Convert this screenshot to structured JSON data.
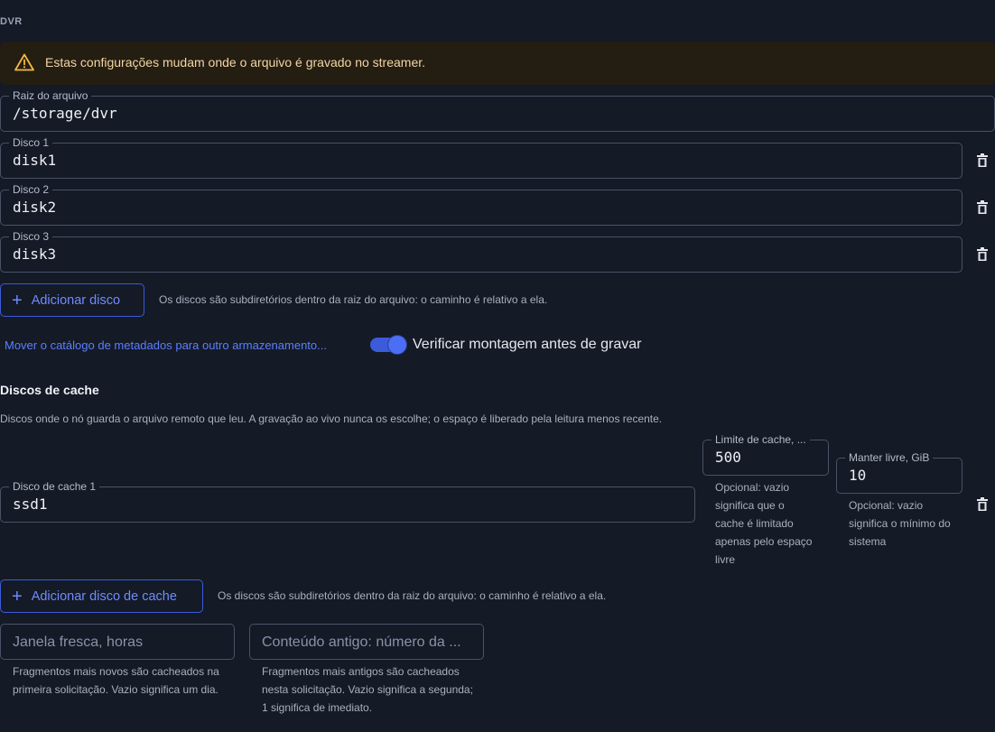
{
  "section": {
    "title": "DVR"
  },
  "warning": {
    "text": "Estas configurações mudam onde o arquivo é gravado no streamer.",
    "icon": "warning-triangle-icon",
    "color": "#f5b942"
  },
  "archive_root": {
    "label": "Raiz do arquivo",
    "value": "/storage/dvr"
  },
  "disks": [
    {
      "label": "Disco 1",
      "value": "disk1"
    },
    {
      "label": "Disco 2",
      "value": "disk2"
    },
    {
      "label": "Disco 3",
      "value": "disk3"
    }
  ],
  "add_disk": {
    "label": "Adicionar disco",
    "hint": "Os discos são subdiretórios dentro da raiz do arquivo: o caminho é relativo a ela."
  },
  "move_catalog_link": "Mover o catálogo de metadados para outro armazenamento...",
  "verify_mount": {
    "label": "Verificar montagem antes de gravar",
    "enabled": true
  },
  "cache": {
    "heading": "Discos de cache",
    "description": "Discos onde o nó guarda o arquivo remoto que leu. A gravação ao vivo nunca os escolhe; o espaço é liberado pela leitura menos recente.",
    "disks": [
      {
        "label": "Disco de cache 1",
        "value": "ssd1",
        "limit": {
          "label": "Limite de cache, ...",
          "value": "500",
          "helper": "Opcional: vazio significa que o cache é limitado apenas pelo espaço livre"
        },
        "keep_free": {
          "label": "Manter livre, GiB",
          "value": "10",
          "helper": "Opcional: vazio significa o mínimo do sistema"
        }
      }
    ],
    "add_label": "Adicionar disco de cache",
    "add_hint": "Os discos são subdiretórios dentro da raiz do arquivo: o caminho é relativo a ela."
  },
  "fresh_window": {
    "placeholder": "Janela fresca, horas",
    "helper": "Fragmentos mais novos são cacheados na primeira solicitação. Vazio significa um dia."
  },
  "old_content": {
    "placeholder": "Conteúdo antigo: número da ...",
    "helper": "Fragmentos mais antigos são cacheados nesta solicitação. Vazio significa a segunda; 1 significa de imediato."
  },
  "colors": {
    "background": "#141a26",
    "accent": "#4c6ef5",
    "warning_bg": "#241d12"
  }
}
